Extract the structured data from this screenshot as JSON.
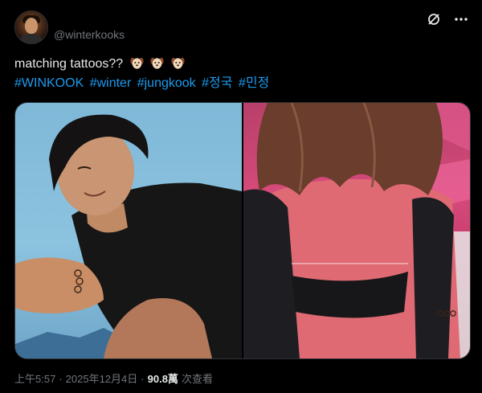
{
  "author": {
    "handle": "@winterkooks"
  },
  "tweet": {
    "text": "matching tattoos??",
    "emoji": [
      "puppy-face-emoji",
      "puppy-face-emoji",
      "puppy-face-emoji"
    ],
    "hashtags": [
      "#WINKOOK",
      "#winter",
      "#jungkook",
      "#정국",
      "#민정"
    ]
  },
  "actions": {
    "grok_icon": "grok-icon",
    "more_icon": "more-icon"
  },
  "media": {
    "left_image": "photo-man-arm-tattoo",
    "right_image": "photo-woman-back-tattoo"
  },
  "meta": {
    "time": "上午5:57",
    "sep1": "·",
    "date": "2025年12月4日",
    "sep2": "·",
    "views_count": "90.8萬",
    "views_label": "次查看"
  },
  "colors": {
    "background": "#000000",
    "text": "#e7e9ea",
    "muted": "#71767b",
    "link": "#1d9bf0"
  }
}
